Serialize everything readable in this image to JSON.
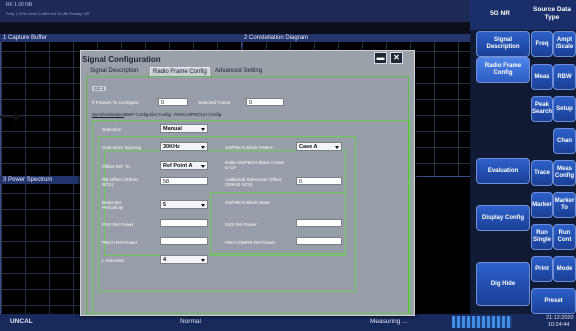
{
  "window": {
    "info_line1": "RF 1.00 NR",
    "info_line2": "Freq 1 GHz  Level 0 dBm  Att 10 dB  Preamp Off"
  },
  "panels": {
    "capture_buffer": "1 Capture Buffer",
    "constellation": "2 Constellation Diagram",
    "power_spectrum": "3 Power Spectrum"
  },
  "side_header": {
    "mode": "5G NR",
    "source_type": "Source Data Type"
  },
  "side_buttons": {
    "signal_description": "Signal Description",
    "freq": "Freq",
    "ampt_scale": "Ampt /Scale",
    "radio_frame_config": "Radio Frame Config",
    "meas": "Meas",
    "rbw": "RBW",
    "peak_search": "Peak Search",
    "setup": "Setup",
    "chan": "Chan",
    "evaluation": "Evaluation",
    "trace": "Trace",
    "meas_config": "Meas Config",
    "marker": "Marker",
    "marker_to": "Marker To",
    "display_config": "Display Config",
    "run_single": "Run Single",
    "run_cont": "Run Cont",
    "dig_hide": "Dig Hide",
    "print": "Print",
    "mode": "Mode",
    "preset": "Preset"
  },
  "status": {
    "uncal": "UNCAL",
    "normal": "Normal",
    "measuring": "Measuring ...",
    "time": "21:12:2020",
    "time2": "10:24:44"
  },
  "dialog": {
    "title": "Signal Configuration",
    "tabs": [
      "Signal Description",
      "Radio Frame Config",
      "Advanced Setting"
    ],
    "cc_label": "CC 1",
    "frames_to_configure_label": "# Frames To Configure",
    "frames_to_configure_value": "0",
    "selected_frame_label": "Selected Frame",
    "selected_frame_value": "0",
    "subtabs": [
      "Synchronization",
      "BWP Config",
      "Slot Config",
      "PDSCH/PDCCH Config"
    ],
    "detection_label": "Detection",
    "detection_value": "Manual",
    "subcarrier_spacing_label": "Subcarrier Spacing",
    "subcarrier_spacing_value": "30KHz",
    "ssb_block_pattern_label": "SS/PBCH Block Pattern",
    "ssb_block_pattern_value": "Case A",
    "offset_ref_label": "Offset Ref. To",
    "offset_ref_value": "Ref Point A",
    "delta_center_label": "Delta SS/PBCH Block Center to CF",
    "rb_offset_label": "RB Offset (30KHz SCS)",
    "rb_offset_value": "58",
    "additional_sc_label": "Additional Subcarrier Offset (30KHz SCS)",
    "additional_sc_value": "0",
    "burst_set_label": "Burst Set Periodicity",
    "burst_set_value": "5",
    "ssb_state_label": "SS/PBCH Block State",
    "pss_label": "PSS Rel Power",
    "sss_label": "SSS Rel Power",
    "pbch_label": "PBCH Rel Power",
    "pbch_dmrs_label": "PBCH DMRS Rel Power",
    "l_selection_label": "L Selection",
    "l_selection_value": "4"
  },
  "colors": {
    "accent": "#2d61c9",
    "green_frame": "#6ccc55",
    "panel_bg": "#000000"
  }
}
